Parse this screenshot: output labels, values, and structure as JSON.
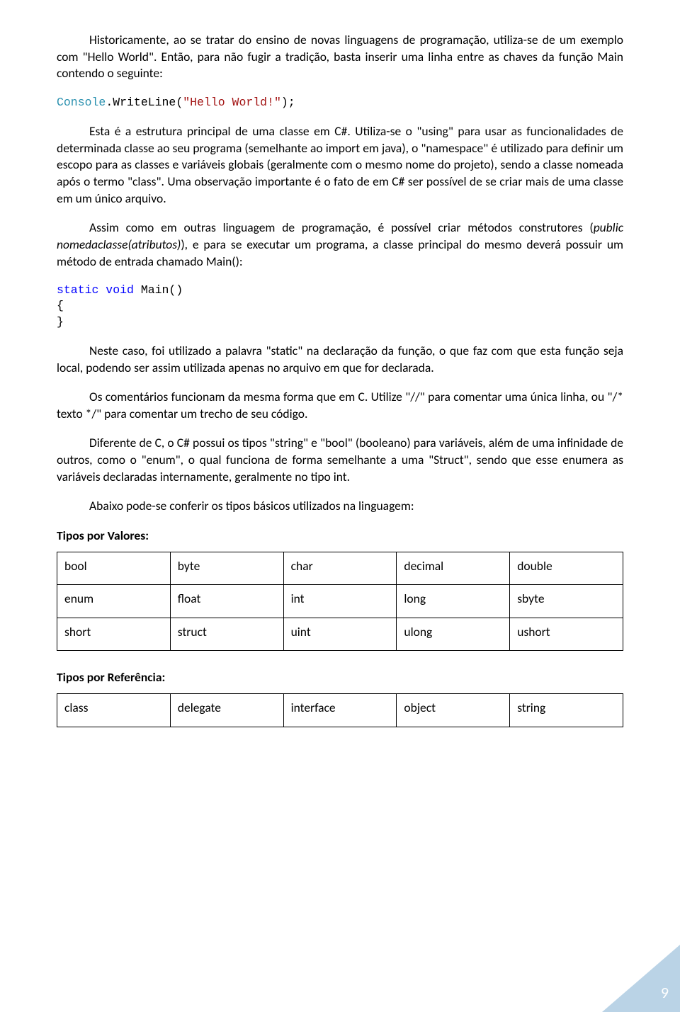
{
  "para1_a": "Historicamente, ao se tratar do ensino de novas linguagens de programação, utiliza-se de um exemplo com \"Hello World\". Então, para não fugir a tradição, basta inserir uma linha entre as chaves da função Main contendo o seguinte:",
  "code1_teal": "Console",
  "code1_mid": ".WriteLine(",
  "code1_str": "\"Hello World!\"",
  "code1_end": ");",
  "para2": "Esta é a estrutura principal de uma classe em C#. Utiliza-se o \"using\" para usar as funcionalidades de determinada classe ao seu programa (semelhante ao import em java), o \"namespace\" é utilizado para definir um escopo para as classes e variáveis globais (geralmente com o mesmo nome do projeto), sendo a classe nomeada após o termo \"class\". Uma observação importante é o fato de em C# ser possível de se criar mais de uma classe em um único arquivo.",
  "para3_a": "Assim como em outras linguagem de programação, é possível criar métodos construtores (",
  "para3_italic": "public nomedaclasse(atributos)",
  "para3_b": "), e para se executar um programa, a classe principal do mesmo deverá possuir um método de entrada chamado Main():",
  "code2_kw": "static void",
  "code2_name": " Main()",
  "code2_open": "{",
  "code2_close": "}",
  "para4": "Neste caso, foi utilizado a palavra \"static\" na declaração da função, o que faz com que esta função seja local, podendo ser assim utilizada apenas no arquivo em que for declarada.",
  "para5": "Os comentários funcionam da mesma forma que em C. Utilize \"//\" para comentar uma única linha, ou \"/* texto */\" para comentar um trecho de seu código.",
  "para6": "Diferente de C, o C# possui os tipos \"string\" e \"bool\" (booleano) para variáveis, além de uma infinidade de outros, como o \"enum\", o qual funciona de forma semelhante a uma \"Struct\", sendo que esse enumera as variáveis declaradas internamente, geralmente no tipo int.",
  "para7": "Abaixo pode-se conferir os tipos básicos utilizados na linguagem:",
  "label_values": "Tipos por Valores:",
  "table_values": [
    [
      "bool",
      "byte",
      "char",
      "decimal",
      "double"
    ],
    [
      "enum",
      "float",
      "int",
      "long",
      "sbyte"
    ],
    [
      "short",
      "struct",
      "uint",
      "ulong",
      "ushort"
    ]
  ],
  "label_ref": "Tipos por Referência:",
  "table_ref": [
    [
      "class",
      "delegate",
      "interface",
      "object",
      "string"
    ]
  ],
  "page_number": "9"
}
